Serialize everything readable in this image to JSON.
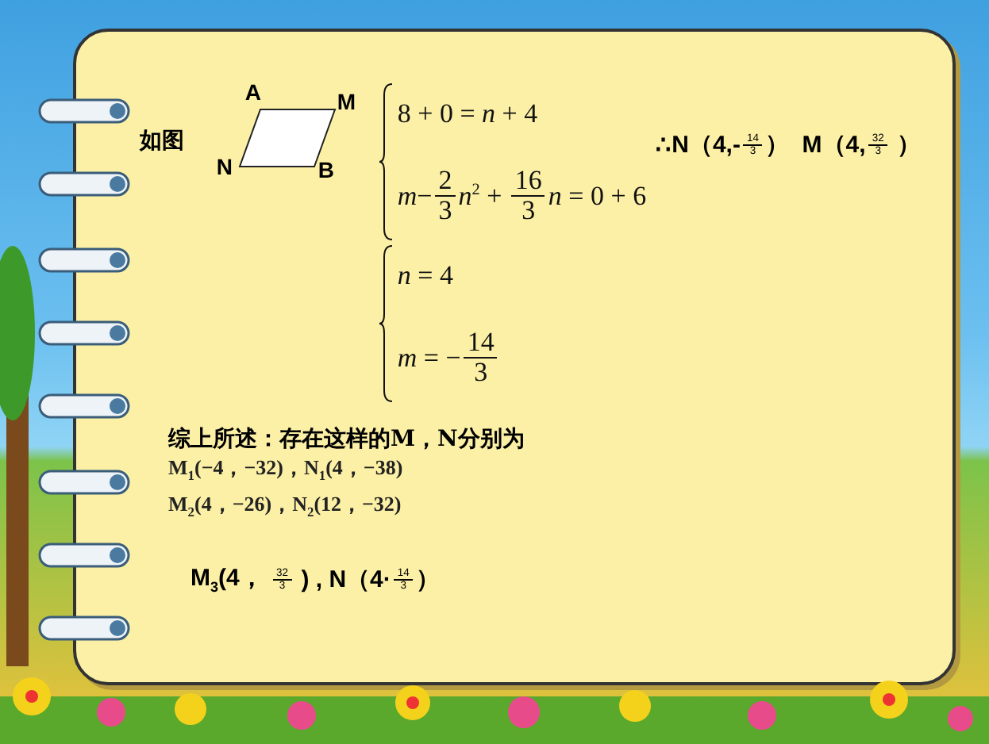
{
  "slide": {
    "intro": "如图",
    "figure": {
      "labels": [
        "A",
        "M",
        "N",
        "B"
      ]
    },
    "systems": [
      {
        "rows": [
          [
            {
              "kind": "text",
              "text": "8 + 0 = *n* + 4"
            }
          ],
          [
            {
              "kind": "text",
              "text": "*m*−"
            },
            {
              "kind": "frac",
              "num": "2",
              "den": "3"
            },
            {
              "kind": "text",
              "text": "*n*$^{2}$ + "
            },
            {
              "kind": "frac",
              "num": "16",
              "den": "3"
            },
            {
              "kind": "text",
              "text": "*n* = 0 + 6"
            }
          ]
        ]
      },
      {
        "rows": [
          [
            {
              "kind": "text",
              "text": "*n* = 4"
            }
          ],
          [
            {
              "kind": "text",
              "text": "*m* = −"
            },
            {
              "kind": "frac",
              "num": "14",
              "den": "3"
            }
          ]
        ]
      }
    ],
    "result": [
      {
        "kind": "text",
        "text": "∴N（4,-"
      },
      {
        "kind": "frac",
        "num": "14",
        "den": "3"
      },
      {
        "kind": "text",
        "text": "）  M（4,"
      },
      {
        "kind": "frac",
        "num": "32",
        "den": "3"
      },
      {
        "kind": "text",
        "text": " ）"
      }
    ],
    "summary": {
      "heading": "综上所述：存在这样的M，N分别为",
      "lines": [
        "M$_{1}$(−4，−32)，N$_{1}$(4，−38)",
        "M$_{2}$(4，−26)，N$_{2}$(12，−32)"
      ]
    },
    "final": [
      {
        "kind": "text",
        "text": "M$_{3}$(4， "
      },
      {
        "kind": "frac",
        "num": "32",
        "den": "3"
      },
      {
        "kind": "text",
        "text": " ) , N（4·"
      },
      {
        "kind": "frac",
        "num": "14",
        "den": "3"
      },
      {
        "kind": "text",
        "text": "）"
      }
    ]
  }
}
